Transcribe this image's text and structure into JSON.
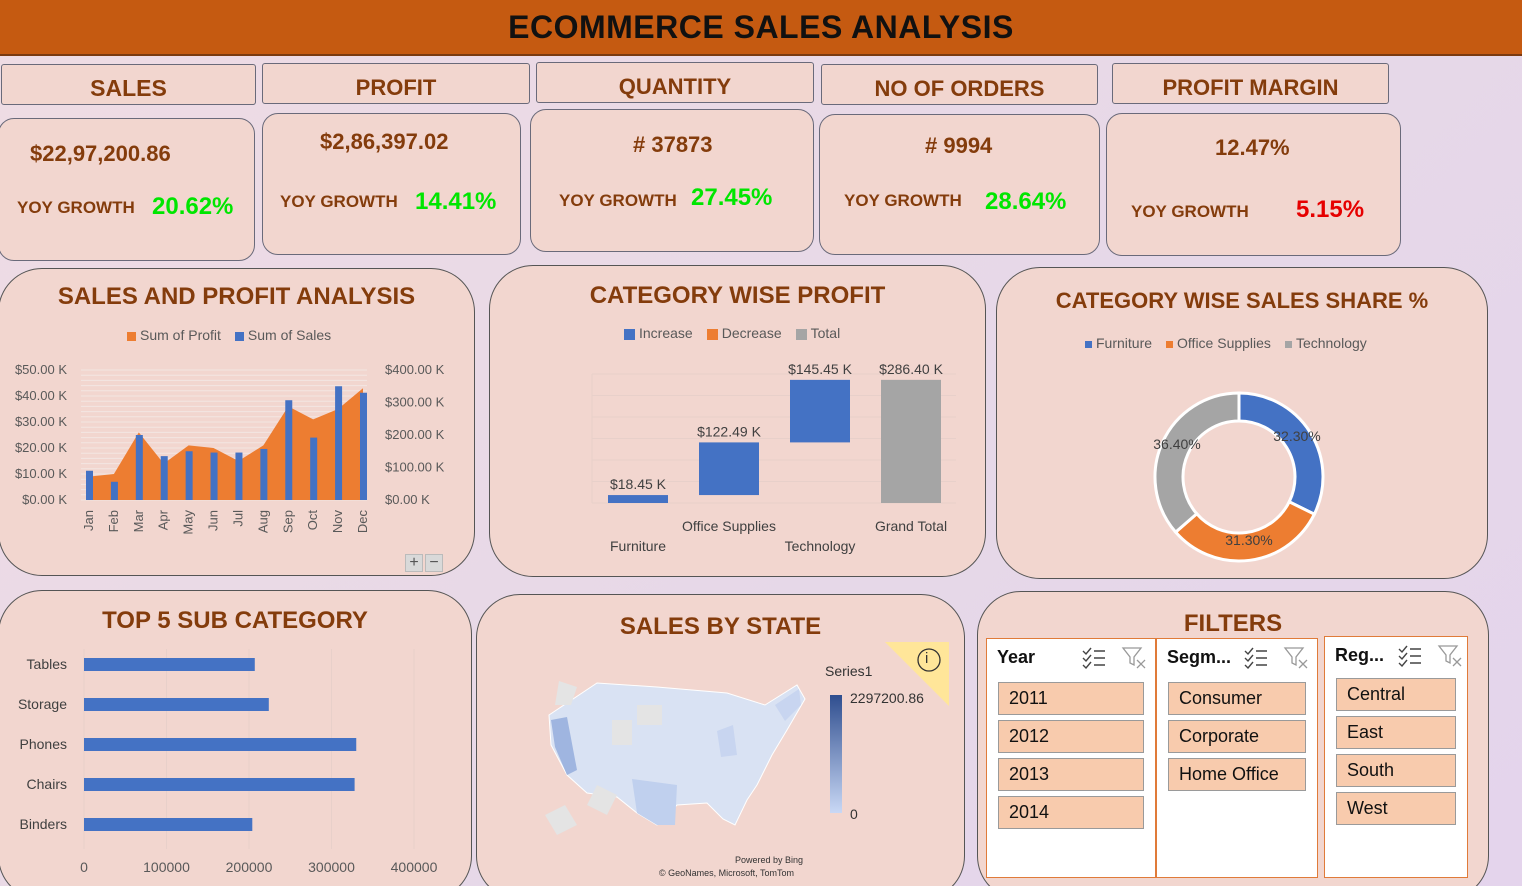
{
  "title": "ECOMMERCE SALES ANALYSIS",
  "kpis": [
    {
      "label": "SALES",
      "value": "$22,97,200.86",
      "yoy_label": "YOY GROWTH",
      "growth": "20.62%",
      "growth_color": "#00e600"
    },
    {
      "label": "PROFIT",
      "value": "$2,86,397.02",
      "yoy_label": "YOY GROWTH",
      "growth": "14.41%",
      "growth_color": "#00e600"
    },
    {
      "label": "QUANTITY",
      "value": "# 37873",
      "yoy_label": "YOY GROWTH",
      "growth": "27.45%",
      "growth_color": "#00e600"
    },
    {
      "label": "NO OF ORDERS",
      "value": "# 9994",
      "yoy_label": "YOY GROWTH",
      "growth": "28.64%",
      "growth_color": "#00e600"
    },
    {
      "label": "PROFIT MARGIN",
      "value": "12.47%",
      "yoy_label": "YOY GROWTH",
      "growth": "5.15%",
      "growth_color": "#e60000"
    }
  ],
  "panels": {
    "sales_profit": {
      "title": "SALES AND PROFIT ANALYSIS",
      "legend": [
        "Sum of Profit",
        "Sum of Sales"
      ]
    },
    "category_profit": {
      "title": "CATEGORY WISE PROFIT",
      "legend": [
        "Increase",
        "Decrease",
        "Total"
      ]
    },
    "category_share": {
      "title": "CATEGORY WISE SALES SHARE %",
      "legend": [
        "Furniture",
        "Office Supplies",
        "Technology"
      ]
    },
    "top5": {
      "title": "TOP 5 SUB CATEGORY"
    },
    "state": {
      "title": "SALES BY STATE",
      "series_label": "Series1",
      "max_label": "2297200.86",
      "min_label": "0",
      "powered": "Powered by Bing",
      "credits": "© GeoNames, Microsoft, TomTom",
      "info_icon": "i"
    },
    "filters": {
      "title": "FILTERS"
    }
  },
  "colors": {
    "orange": "#ed7d31",
    "blue": "#4472c4",
    "gray": "#a5a5a5",
    "accent": "#c55a11",
    "text_brown": "#843c0c"
  },
  "chart_data": [
    {
      "type": "bar+area",
      "title": "SALES AND PROFIT ANALYSIS",
      "categories": [
        "Jan",
        "Feb",
        "Mar",
        "Apr",
        "May",
        "Jun",
        "Jul",
        "Aug",
        "Sep",
        "Oct",
        "Nov",
        "Dec"
      ],
      "series": [
        {
          "name": "Sum of Profit",
          "type": "area",
          "axis": "left",
          "values": [
            9000,
            10000,
            26000,
            14000,
            21000,
            20000,
            15000,
            21000,
            36000,
            31000,
            35000,
            43000
          ]
        },
        {
          "name": "Sum of Sales",
          "type": "bar",
          "axis": "right",
          "values": [
            90000,
            56000,
            200000,
            135000,
            150000,
            146000,
            146000,
            157000,
            307000,
            192000,
            350000,
            330000
          ]
        }
      ],
      "left_ticks": [
        "$0.00 K",
        "$10.00 K",
        "$20.00 K",
        "$30.00 K",
        "$40.00 K",
        "$50.00 K"
      ],
      "right_ticks": [
        "$0.00 K",
        "$100.00 K",
        "$200.00 K",
        "$300.00 K",
        "$400.00 K"
      ],
      "ylim_left": [
        0,
        50000
      ],
      "ylim_right": [
        0,
        400000
      ]
    },
    {
      "type": "waterfall",
      "title": "CATEGORY WISE PROFIT",
      "categories": [
        "Furniture",
        "Office Supplies",
        "Technology",
        "Grand Total"
      ],
      "values": [
        18450,
        122490,
        145450,
        286400
      ],
      "labels": [
        "$18.45 K",
        "$122.49 K",
        "$145.45 K",
        "$286.40 K"
      ],
      "kinds": [
        "increase",
        "increase",
        "increase",
        "total"
      ]
    },
    {
      "type": "pie",
      "title": "CATEGORY WISE SALES SHARE %",
      "categories": [
        "Furniture",
        "Office Supplies",
        "Technology"
      ],
      "values": [
        32.3,
        31.3,
        36.4
      ],
      "labels": [
        "32.30%",
        "31.30%",
        "36.40%"
      ]
    },
    {
      "type": "bar",
      "title": "TOP 5 SUB CATEGORY",
      "categories": [
        "Tables",
        "Storage",
        "Phones",
        "Chairs",
        "Binders"
      ],
      "values": [
        207000,
        224000,
        330000,
        328000,
        204000
      ],
      "x_ticks": [
        "0",
        "100000",
        "200000",
        "300000",
        "400000"
      ],
      "xlim": [
        0,
        400000
      ]
    }
  ],
  "filters": {
    "year": {
      "header": "Year",
      "items": [
        "2011",
        "2012",
        "2013",
        "2014"
      ]
    },
    "segment": {
      "header": "Segm...",
      "items": [
        "Consumer",
        "Corporate",
        "Home Office"
      ]
    },
    "region": {
      "header": "Reg...",
      "items": [
        "Central",
        "East",
        "South",
        "West"
      ]
    }
  },
  "zoom": {
    "plus": "+",
    "minus": "−"
  }
}
